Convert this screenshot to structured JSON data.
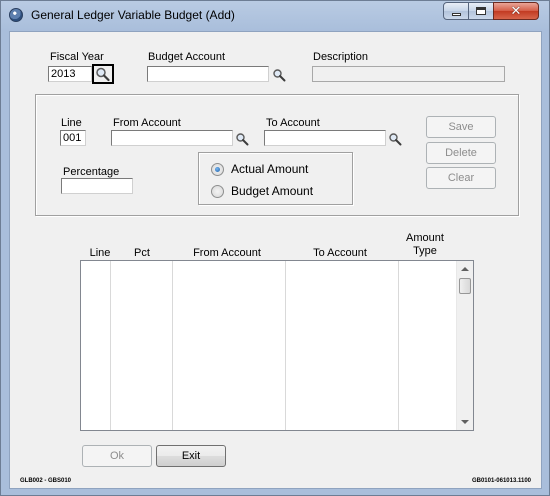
{
  "window": {
    "title": "General Ledger Variable Budget (Add)"
  },
  "header": {
    "fiscal_year_label": "Fiscal Year",
    "fiscal_year_value": "2013",
    "budget_account_label": "Budget Account",
    "budget_account_value": "",
    "description_label": "Description",
    "description_value": ""
  },
  "detail": {
    "line_label": "Line",
    "line_value": "001",
    "from_account_label": "From Account",
    "from_account_value": "",
    "to_account_label": "To Account",
    "to_account_value": "",
    "percentage_label": "Percentage",
    "percentage_value": "",
    "amount_options": [
      {
        "label": "Actual Amount",
        "selected": true
      },
      {
        "label": "Budget Amount",
        "selected": false
      }
    ],
    "save_label": "Save",
    "delete_label": "Delete",
    "clear_label": "Clear"
  },
  "grid": {
    "columns": [
      "Line",
      "Pct",
      "From Account",
      "To Account",
      "Amount Type"
    ],
    "column_amount_type_line1": "Amount",
    "column_amount_type_line2": "Type",
    "rows": []
  },
  "buttons": {
    "ok_label": "Ok",
    "exit_label": "Exit"
  },
  "footer": {
    "left_code": "GLB002 - GBS010",
    "right_code": "GB0101-061013.1100"
  },
  "icons": {
    "app": "app-globe-icon",
    "lookup": "magnifier-icon",
    "minimize": "minimize-icon",
    "maximize": "maximize-icon",
    "close": "close-icon"
  }
}
